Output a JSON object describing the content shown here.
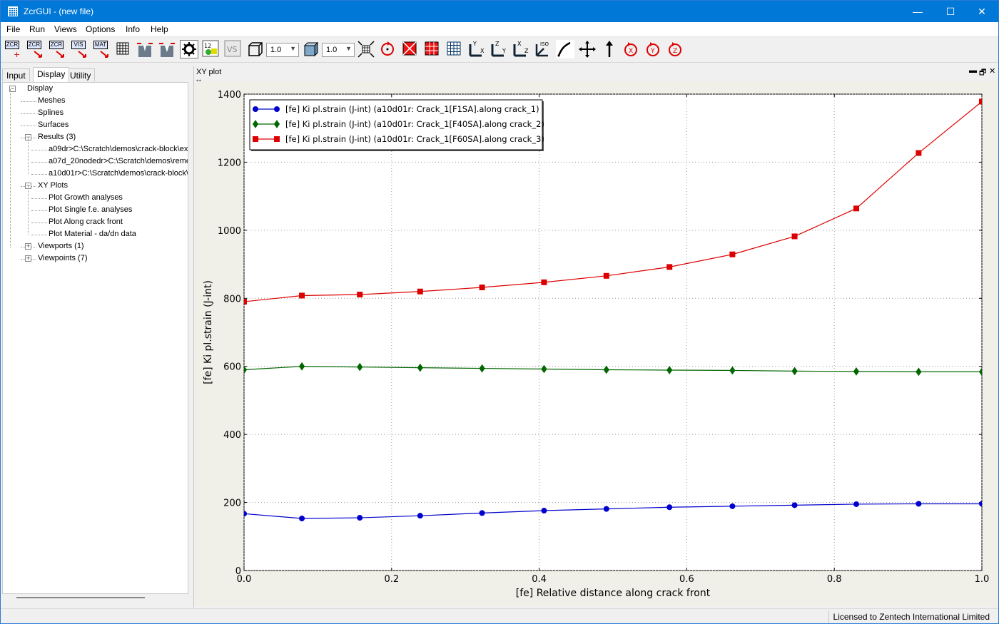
{
  "window": {
    "title": "ZcrGUI - (new file)",
    "minimize": "—",
    "maximize": "☐",
    "close": "✕"
  },
  "menu": [
    "File",
    "Run",
    "Views",
    "Options",
    "Info",
    "Help"
  ],
  "toolbar": {
    "icon_labels": [
      "ZCR",
      "ZCR",
      "ZCR",
      "VIS",
      "MAT"
    ],
    "scale_combo_1": "1.0",
    "scale_combo_2": "1.0",
    "numeric_icon_text": "12",
    "vs_text": "VS",
    "axis_labels": [
      "Y",
      "X",
      "Z",
      "Y",
      "X",
      "Z",
      "ISO"
    ],
    "rotate_labels": [
      "X",
      "Y",
      "Z"
    ]
  },
  "left_panel": {
    "tabs": [
      "Input",
      "Display",
      "Utility"
    ],
    "active_tab": "Display",
    "tree": [
      {
        "label": "Display",
        "level": 0,
        "expander": "minus"
      },
      {
        "label": "Meshes",
        "level": 1
      },
      {
        "label": "Splines",
        "level": 1
      },
      {
        "label": "Surfaces",
        "level": 1
      },
      {
        "label": "Results (3)",
        "level": 1,
        "expander": "minus"
      },
      {
        "label": "a09dr>C:\\Scratch\\demos\\crack-block\\ex",
        "level": 2
      },
      {
        "label": "a07d_20nodedr>C:\\Scratch\\demos\\reme",
        "level": 2
      },
      {
        "label": "a10d01r>C:\\Scratch\\demos\\crack-block\\",
        "level": 2
      },
      {
        "label": "XY Plots",
        "level": 1,
        "expander": "minus"
      },
      {
        "label": "Plot Growth analyses",
        "level": 2
      },
      {
        "label": "Plot Single f.e. analyses",
        "level": 2
      },
      {
        "label": "Plot Along crack front",
        "level": 2
      },
      {
        "label": "Plot Material - da/dn data",
        "level": 2
      },
      {
        "label": "Viewports (1)",
        "level": 1,
        "expander": "plus"
      },
      {
        "label": "Viewpoints (7)",
        "level": 1,
        "expander": "plus"
      }
    ]
  },
  "xy_panel": {
    "title": "XY plot",
    "stars": "**",
    "buttons": [
      "▬",
      "🗗",
      "✕"
    ]
  },
  "chart_data": {
    "type": "line",
    "title": "",
    "xlabel": "[fe] Relative distance along crack front",
    "ylabel": "[fe] Ki pl.strain (J-int)",
    "xlim": [
      0.0,
      1.0
    ],
    "ylim": [
      0,
      1400
    ],
    "xticks": [
      "0.0",
      "0.2",
      "0.4",
      "0.6",
      "0.8",
      "1.0"
    ],
    "yticks": [
      "0",
      "200",
      "400",
      "600",
      "800",
      "1000",
      "1200",
      "1400"
    ],
    "grid": true,
    "legend_position": "top-left",
    "x": [
      0.0,
      0.0784,
      0.1569,
      0.2387,
      0.3226,
      0.4066,
      0.4911,
      0.5766,
      0.6619,
      0.7462,
      0.8298,
      0.9143,
      1.0
    ],
    "series": [
      {
        "name": "[fe] Ki pl.strain (J-int) (a10d01r: Crack_1[F1SA].along crack_1)",
        "color": "#0000cc",
        "marker": "circle",
        "values": [
          167,
          153,
          155,
          161,
          169,
          176,
          181,
          186,
          189,
          192,
          195,
          196,
          196
        ]
      },
      {
        "name": "[fe] Ki pl.strain (J-int) (a10d01r: Crack_1[F40SA].along crack_2)",
        "color": "#006600",
        "marker": "diamond",
        "values": [
          590,
          600,
          598,
          596,
          594,
          592,
          590,
          589,
          588,
          586,
          585,
          584,
          584
        ]
      },
      {
        "name": "[fe] Ki pl.strain (J-int) (a10d01r: Crack_1[F60SA].along crack_3)",
        "color": "#dd0000",
        "marker": "square",
        "values": [
          790,
          808,
          811,
          820,
          832,
          847,
          866,
          892,
          929,
          982,
          1064,
          1227,
          1378
        ]
      }
    ]
  },
  "status": {
    "license": "Licensed to Zentech International Limited"
  }
}
